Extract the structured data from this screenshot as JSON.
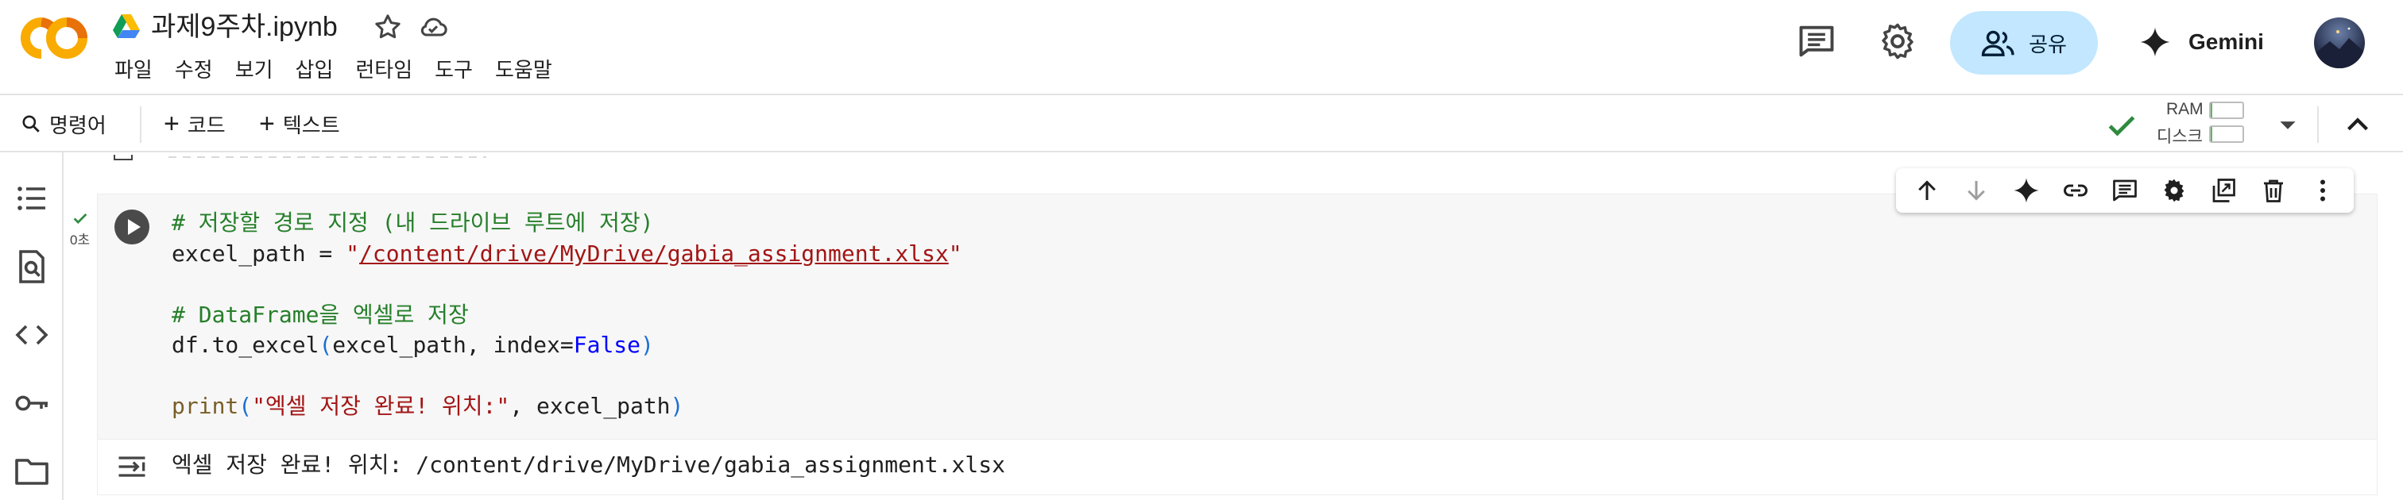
{
  "header": {
    "title": "과제9주차.ipynb",
    "menu": [
      "파일",
      "수정",
      "보기",
      "삽입",
      "런타임",
      "도구",
      "도움말"
    ],
    "share_label": "공유",
    "gemini_label": "Gemini"
  },
  "toolbar": {
    "command_label": "명령어",
    "add_code_label": "코드",
    "add_text_label": "텍스트",
    "ram_label": "RAM",
    "disk_label": "디스크",
    "ram_usage": 0.05,
    "disk_usage": 0.05
  },
  "cell": {
    "exec_time": "0초",
    "code": {
      "comment1": "# 저장할 경로 지정 (내 드라이브 루트에 저장)",
      "line2_var": "excel_path = ",
      "line2_q1": "\"",
      "line2_path": "/content/drive/MyDrive/gabia_assignment.xlsx",
      "line2_q2": "\"",
      "comment2": "# DataFrame을 엑셀로 저장",
      "line5_a": "df.to_excel",
      "line5_p1": "(",
      "line5_b": "excel_path, index=",
      "line5_kw": "False",
      "line5_p2": ")",
      "line7_fn": "print",
      "line7_p1": "(",
      "line7_str": "\"엑셀 저장 완료! 위치:\"",
      "line7_b": ", excel_path",
      "line7_p2": ")"
    },
    "output": "엑셀 저장 완료! 위치: /content/drive/MyDrive/gabia_assignment.xlsx"
  },
  "colors": {
    "share_bg": "#c2e7ff",
    "comment": "#267f2a",
    "string": "#a31515",
    "keyword": "#0000ff",
    "success": "#2e8b3e"
  }
}
